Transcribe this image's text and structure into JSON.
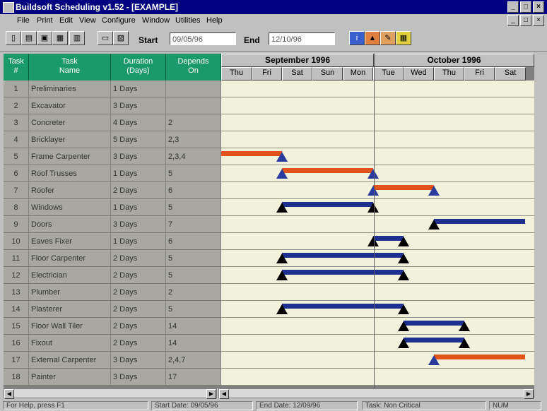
{
  "window": {
    "title": "Buildsoft Scheduling v1.52 - [EXAMPLE]"
  },
  "menu": [
    "File",
    "Print",
    "Edit",
    "View",
    "Configure",
    "Window",
    "Utilities",
    "Help"
  ],
  "toolbar": {
    "start_label": "Start",
    "start_value": "09/05/96",
    "end_label": "End",
    "end_value": "12/10/96"
  },
  "columns": {
    "task_num": [
      "Task",
      "#"
    ],
    "task_name": [
      "Task",
      "Name"
    ],
    "duration": [
      "Duration",
      "(Days)"
    ],
    "depends": [
      "Depends",
      "On"
    ]
  },
  "months": [
    "September 1996",
    "October 1996"
  ],
  "days": [
    "Thu",
    "Fri",
    "Sat",
    "Sun",
    "Mon",
    "Tue",
    "Wed",
    "Thu",
    "Fri",
    "Sat"
  ],
  "tasks": [
    {
      "num": "1",
      "name": "Preliminaries",
      "duration": "1 Days",
      "depends": ""
    },
    {
      "num": "2",
      "name": "Excavator",
      "duration": "3 Days",
      "depends": ""
    },
    {
      "num": "3",
      "name": "Concreter",
      "duration": "4 Days",
      "depends": "2"
    },
    {
      "num": "4",
      "name": "Bricklayer",
      "duration": "5 Days",
      "depends": "2,3"
    },
    {
      "num": "5",
      "name": "Frame Carpenter",
      "duration": "3 Days",
      "depends": "2,3,4"
    },
    {
      "num": "6",
      "name": "Roof Trusses",
      "duration": "1 Days",
      "depends": "5"
    },
    {
      "num": "7",
      "name": "Roofer",
      "duration": "2 Days",
      "depends": "6"
    },
    {
      "num": "8",
      "name": "Windows",
      "duration": "1 Days",
      "depends": "5"
    },
    {
      "num": "9",
      "name": "Doors",
      "duration": "3 Days",
      "depends": "7"
    },
    {
      "num": "10",
      "name": "Eaves Fixer",
      "duration": "1 Days",
      "depends": "6"
    },
    {
      "num": "11",
      "name": "Floor Carpenter",
      "duration": "2 Days",
      "depends": "5"
    },
    {
      "num": "12",
      "name": "Electrician",
      "duration": "2 Days",
      "depends": "5"
    },
    {
      "num": "13",
      "name": "Plumber",
      "duration": "2 Days",
      "depends": "2"
    },
    {
      "num": "14",
      "name": "Plasterer",
      "duration": "2 Days",
      "depends": "5"
    },
    {
      "num": "15",
      "name": "Floor Wall Tiler",
      "duration": "2 Days",
      "depends": "14"
    },
    {
      "num": "16",
      "name": "Fixout",
      "duration": "2 Days",
      "depends": "14"
    },
    {
      "num": "17",
      "name": "External Carpenter",
      "duration": "3 Days",
      "depends": "2,4,7"
    },
    {
      "num": "18",
      "name": "Painter",
      "duration": "3 Days",
      "depends": "17"
    }
  ],
  "gantt": {
    "bars": [
      {
        "row": 5,
        "start": 0.0,
        "end": 2.0,
        "color": "#e0541a",
        "start_tri": "none",
        "end_tri": "#2b3b9b"
      },
      {
        "row": 6,
        "start": 2.0,
        "end": 5.0,
        "color": "#e0541a",
        "start_tri": "#2b3b9b",
        "end_tri": "#2b3b9b"
      },
      {
        "row": 7,
        "start": 5.0,
        "end": 7.0,
        "color": "#e0541a",
        "start_tri": "#2b3b9b",
        "end_tri": "#2b3b9b"
      },
      {
        "row": 8,
        "start": 2.0,
        "end": 5.0,
        "color": "#1e2f8f",
        "start_tri": "#000000",
        "end_tri": "#000000"
      },
      {
        "row": 9,
        "start": 7.0,
        "end": 10.0,
        "color": "#1e2f8f",
        "start_tri": "#000000",
        "end_tri": "none"
      },
      {
        "row": 10,
        "start": 5.0,
        "end": 6.0,
        "color": "#1e2f8f",
        "start_tri": "#000000",
        "end_tri": "#000000"
      },
      {
        "row": 11,
        "start": 2.0,
        "end": 6.0,
        "color": "#1e2f8f",
        "start_tri": "#000000",
        "end_tri": "#000000"
      },
      {
        "row": 12,
        "start": 2.0,
        "end": 6.0,
        "color": "#1e2f8f",
        "start_tri": "#000000",
        "end_tri": "#000000"
      },
      {
        "row": 14,
        "start": 2.0,
        "end": 6.0,
        "color": "#1e2f8f",
        "start_tri": "#000000",
        "end_tri": "#000000"
      },
      {
        "row": 15,
        "start": 6.0,
        "end": 8.0,
        "color": "#1e2f8f",
        "start_tri": "#000000",
        "end_tri": "#000000"
      },
      {
        "row": 16,
        "start": 6.0,
        "end": 8.0,
        "color": "#1e2f8f",
        "start_tri": "#000000",
        "end_tri": "#000000"
      },
      {
        "row": 17,
        "start": 7.0,
        "end": 10.0,
        "color": "#e0541a",
        "start_tri": "#2b3b9b",
        "end_tri": "none"
      }
    ]
  },
  "status": {
    "help": "For Help, press F1",
    "start_date": "Start Date: 09/05/96",
    "end_date": "End Date: 12/09/96",
    "task": "Task: Non Critical",
    "num": "NUM"
  },
  "colors": {
    "header_green": "#1a9a6a",
    "critical": "#e0541a",
    "noncritical": "#1e2f8f",
    "gantt_bg": "#f2f2dc"
  }
}
